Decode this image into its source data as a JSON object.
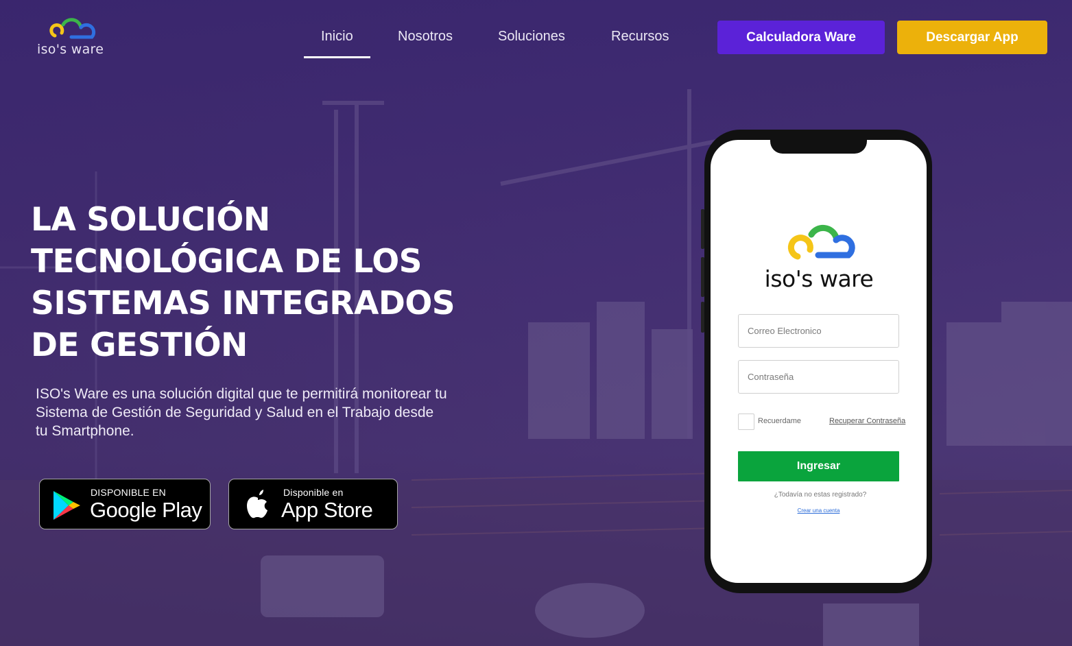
{
  "header": {
    "logo_text": "iso's ware",
    "nav": [
      {
        "label": "Inicio",
        "active": true
      },
      {
        "label": "Nosotros",
        "active": false
      },
      {
        "label": "Soluciones",
        "active": false
      },
      {
        "label": "Recursos",
        "active": false
      }
    ],
    "calc_button": "Calculadora Ware",
    "download_button": "Descargar App"
  },
  "hero": {
    "title_lines": [
      "LA SOLUCIÓN",
      "TECNOLÓGICA DE LOS",
      "SISTEMAS INTEGRADOS",
      "DE GESTIÓN"
    ],
    "description": "ISO's Ware es una solución digital que te permitirá monitorear tu Sistema de Gestión de Seguridad y Salud en el Trabajo desde tu Smartphone."
  },
  "badges": {
    "google": {
      "small": "DISPONIBLE EN",
      "big": "Google Play"
    },
    "apple": {
      "small": "Disponible en",
      "big": "App Store"
    }
  },
  "phone_app": {
    "logo_text": "iso's ware",
    "email_placeholder": "Correo Electronico",
    "password_placeholder": "Contraseña",
    "remember_label": "Recuerdame",
    "recover_link": "Recuperar Contraseña",
    "login_button": "Ingresar",
    "not_registered": "¿Todavía no estas registrado?",
    "create_account": "Crear una cuenta"
  },
  "colors": {
    "calc_button": "#5b22d8",
    "download_button": "#ecb10b",
    "login_button": "#0aa43d",
    "hero_overlay": "#3a2a66"
  }
}
